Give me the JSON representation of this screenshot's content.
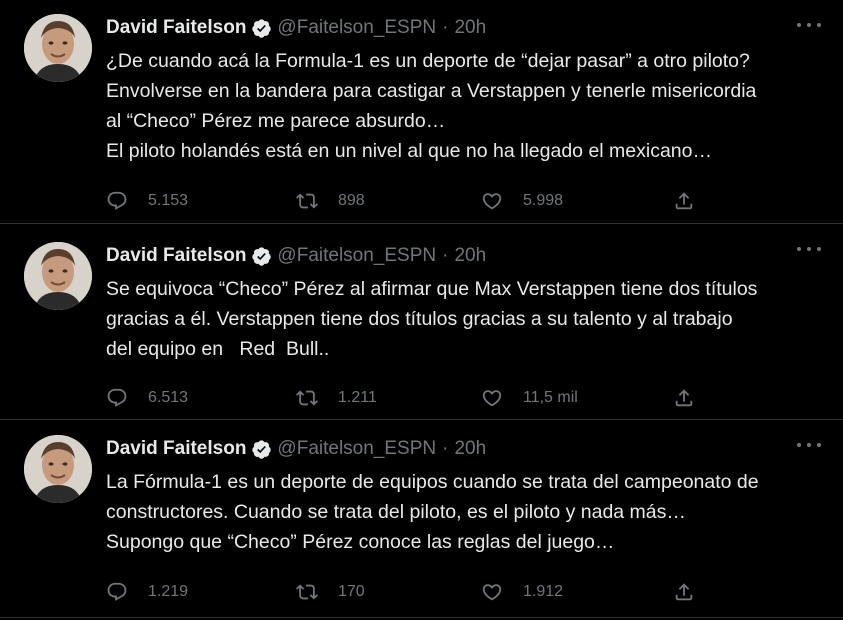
{
  "colors": {
    "background": "#000000",
    "text_primary": "#e7e9ea",
    "text_secondary": "#71767b",
    "divider": "#2f3336",
    "verified_badge": "#e7e9ea"
  },
  "tweets": [
    {
      "author": {
        "name": "David Faitelson",
        "handle": "@Faitelson_ESPN",
        "avatar_icon": "profile-photo",
        "verified_icon": "verified-badge-icon"
      },
      "time": "20h",
      "separator": "·",
      "lines": [
        "¿De cuando acá la Formula-1 es un deporte de “dejar pasar” a otro piloto?",
        "Envolverse en la bandera para castigar a Verstappen y tenerle misericordia",
        "al “Checo” Pérez me parece absurdo…",
        "El piloto holandés está en un nivel al que no ha llegado el mexicano…"
      ],
      "stats": {
        "replies": "5.153",
        "retweets": "898",
        "likes": "5.998"
      }
    },
    {
      "author": {
        "name": "David Faitelson",
        "handle": "@Faitelson_ESPN",
        "avatar_icon": "profile-photo",
        "verified_icon": "verified-badge-icon"
      },
      "time": "20h",
      "separator": "·",
      "lines": [
        "Se equivoca “Checo” Pérez al afirmar que Max Verstappen tiene dos títulos",
        "gracias a él. Verstappen tiene dos títulos gracias a su talento y al trabajo",
        "del equipo en   Red  Bull.."
      ],
      "stats": {
        "replies": "6.513",
        "retweets": "1.211",
        "likes": "11,5 mil"
      }
    },
    {
      "author": {
        "name": "David Faitelson",
        "handle": "@Faitelson_ESPN",
        "avatar_icon": "profile-photo",
        "verified_icon": "verified-badge-icon"
      },
      "time": "20h",
      "separator": "·",
      "lines": [
        "La Fórmula-1 es un deporte de equipos cuando se trata del campeonato de",
        "constructores. Cuando se trata del piloto, es el piloto y nada más…",
        "Supongo que “Checo” Pérez conoce las reglas del juego…"
      ],
      "stats": {
        "replies": "1.219",
        "retweets": "170",
        "likes": "1.912"
      }
    }
  ],
  "icons": {
    "reply": "reply-icon",
    "retweet": "retweet-icon",
    "like": "heart-icon",
    "share": "share-icon",
    "more": "more-options-icon"
  }
}
